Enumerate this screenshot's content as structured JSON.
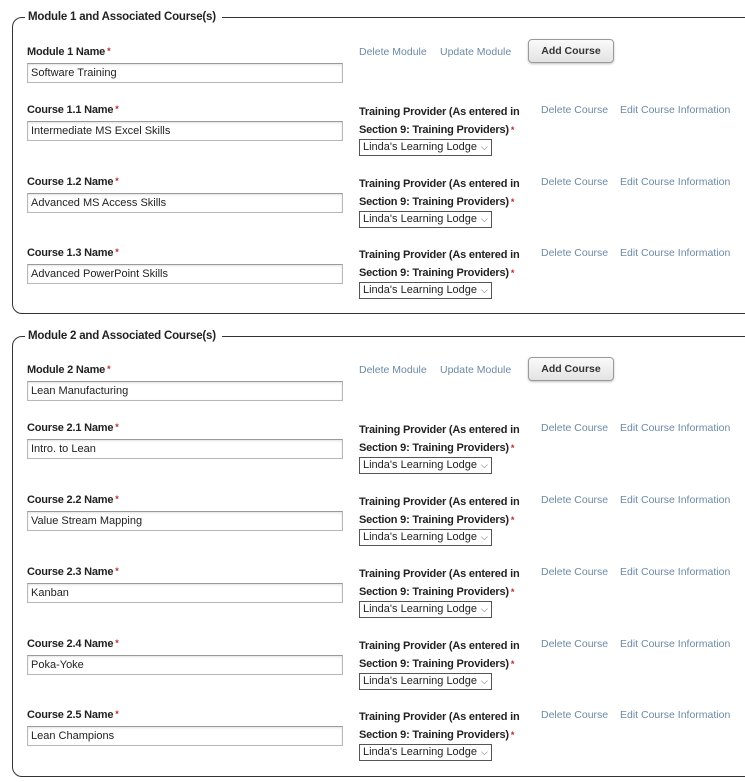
{
  "common": {
    "required_marker": "*",
    "provider_label": "Training Provider (As entered in Section 9: Training Providers)",
    "delete_course": "Delete Course",
    "edit_course": "Edit Course Information",
    "delete_module": "Delete Module",
    "update_module": "Update Module",
    "add_course": "Add Course",
    "chevron": "⌵"
  },
  "modules": [
    {
      "legend": "Module 1 and Associated Course(s)",
      "name_label": "Module 1 Name",
      "name_value": "Software Training",
      "courses": [
        {
          "label": "Course 1.1 Name",
          "value": "Intermediate MS Excel Skills",
          "provider": "Linda's Learning Lodge"
        },
        {
          "label": "Course 1.2 Name",
          "value": "Advanced MS Access Skills",
          "provider": "Linda's Learning Lodge"
        },
        {
          "label": "Course 1.3 Name",
          "value": "Advanced PowerPoint Skills",
          "provider": "Linda's Learning Lodge"
        }
      ]
    },
    {
      "legend": "Module 2 and Associated Course(s)",
      "name_label": "Module 2 Name",
      "name_value": "Lean Manufacturing",
      "courses": [
        {
          "label": "Course 2.1 Name",
          "value": "Intro. to Lean",
          "provider": "Linda's Learning Lodge"
        },
        {
          "label": "Course 2.2 Name",
          "value": "Value Stream Mapping",
          "provider": "Linda's Learning Lodge"
        },
        {
          "label": "Course 2.3 Name",
          "value": "Kanban",
          "provider": "Linda's Learning Lodge"
        },
        {
          "label": "Course 2.4 Name",
          "value": "Poka-Yoke",
          "provider": "Linda's Learning Lodge"
        },
        {
          "label": "Course 2.5 Name",
          "value": "Lean Champions",
          "provider": "Linda's Learning Lodge"
        }
      ]
    }
  ]
}
